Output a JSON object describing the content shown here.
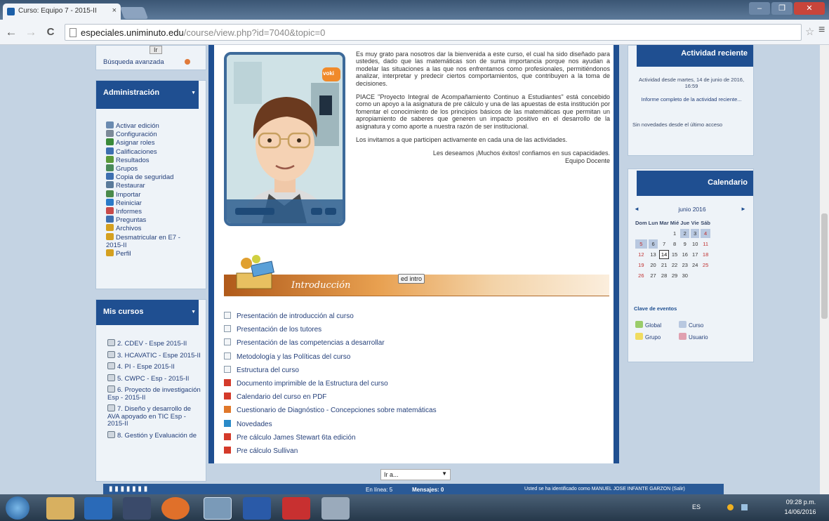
{
  "browser": {
    "tab_title": "Curso: Equipo 7 - 2015-II",
    "tab_close": "×",
    "url_domain": "especiales.uniminuto.edu",
    "url_path": "/course/view.php?id=7040&topic=0",
    "back": "←",
    "forward": "→",
    "reload": "C",
    "star": "☆",
    "menu": "≡",
    "window_buttons": [
      "–",
      "❐",
      "✕"
    ]
  },
  "left": {
    "search_button": "Ir",
    "advanced_search": "Búsqueda avanzada",
    "admin": {
      "title": "Administración",
      "items": [
        {
          "label": "Activar edición",
          "icon": "pencil-icon",
          "color": "#6a8ab0"
        },
        {
          "label": "Configuración",
          "icon": "gear-icon",
          "color": "#7c8a99"
        },
        {
          "label": "Asignar roles",
          "icon": "users-icon",
          "color": "#3a8a3a"
        },
        {
          "label": "Calificaciones",
          "icon": "grades-icon",
          "color": "#3d6fb0"
        },
        {
          "label": "Resultados",
          "icon": "results-icon",
          "color": "#5a9a3a"
        },
        {
          "label": "Grupos",
          "icon": "groups-icon",
          "color": "#4a8a5a"
        },
        {
          "label": "Copia de seguridad",
          "icon": "backup-icon",
          "color": "#3d6fb0"
        },
        {
          "label": "Restaurar",
          "icon": "restore-icon",
          "color": "#5a7a9a"
        },
        {
          "label": "Importar",
          "icon": "import-icon",
          "color": "#4a8a4a"
        },
        {
          "label": "Reiniciar",
          "icon": "reset-icon",
          "color": "#2a7ac8"
        },
        {
          "label": "Informes",
          "icon": "reports-icon",
          "color": "#c84a4a"
        },
        {
          "label": "Preguntas",
          "icon": "questions-icon",
          "color": "#3d6fb0"
        },
        {
          "label": "Archivos",
          "icon": "files-icon",
          "color": "#d4a020"
        },
        {
          "label": "Desmatricular en E7 - 2015-II",
          "icon": "unenrol-icon",
          "color": "#d4a020"
        },
        {
          "label": "Perfil",
          "icon": "profile-icon",
          "color": "#d4a020"
        }
      ]
    },
    "courses": {
      "title": "Mis cursos",
      "items": [
        "2. CDEV - Espe 2015-II",
        "3. HCAVATIC - Espe 2015-II",
        "4. PI - Espe 2015-II",
        "5. CWPC - Esp - 2015-II",
        "6. Proyecto de investigación Esp - 2015-II",
        "7. Diseño y desarrollo de AVA apoyado en TIC Esp - 2015-II",
        "8. Gestión y Evaluación de"
      ]
    }
  },
  "center": {
    "avatar_badge": "voki",
    "intro_paragraphs": [
      "Es muy grato para nosotros dar la bienvenida a este curso, el cual ha sido diseñado para ustedes, dado que las matemáticas son de suma importancia porque nos ayudan a modelar las situaciones a las que nos enfrentamos como profesionales, permitiéndonos analizar, interpretar y predecir ciertos comportamientos, que contribuyen a la toma de decisiones.",
      "PIACE \"Proyecto Integral de Acompañamiento Continuo a Estudiantes\" está concebido como un apoyo a la asignatura de pre cálculo y una de las apuestas de esta institución por fomentar el conocimiento de los principios básicos de las matemáticas que permitan un apropiamiento de saberes que generen un impacto positivo en el desarrollo de la asignatura y como aporte a nuestra razón de ser institucional.",
      "Los invitamos a que participen activamente en cada una de las actividades."
    ],
    "closing": "Les deseamos ¡Muchos éxitos! confiamos en sus capacidades.",
    "signature": "Equipo Docente",
    "banner_title": "Introducción",
    "edit_button": "ed intro",
    "activities": [
      {
        "label": "Presentación de introducción al curso",
        "icon": "page-icon",
        "color": "#8a9aaa"
      },
      {
        "label": "Presentación de los tutores",
        "icon": "page-icon",
        "color": "#8a9aaa"
      },
      {
        "label": "Presentación de las competencias a desarrollar",
        "icon": "page-icon",
        "color": "#8a9aaa"
      },
      {
        "label": "Metodología y las Políticas del curso",
        "icon": "page-icon",
        "color": "#8a9aaa"
      },
      {
        "label": "Estructura del curso",
        "icon": "page-icon",
        "color": "#8a9aaa"
      },
      {
        "label": "Documento imprimible de la Estructura del curso",
        "icon": "pdf-icon",
        "color": "#d43a2a"
      },
      {
        "label": "Calendario del curso en PDF",
        "icon": "pdf-icon",
        "color": "#d43a2a"
      },
      {
        "label": "Cuestionario de Diagnóstico - Concepciones sobre matemáticas",
        "icon": "quiz-icon",
        "color": "#e0782a"
      },
      {
        "label": "Novedades",
        "icon": "forum-icon",
        "color": "#2a8ac8"
      },
      {
        "label": "Pre cálculo James Stewart 6ta edición",
        "icon": "pdf-icon",
        "color": "#d43a2a"
      },
      {
        "label": "Pre cálculo Sullivan",
        "icon": "pdf-icon",
        "color": "#d43a2a"
      }
    ],
    "jump_select": "Ir a..."
  },
  "right": {
    "activity": {
      "title": "Actividad reciente",
      "since": "Actividad desde martes, 14 de junio de 2016, 16:59",
      "full_report": "Informe completo de la actividad reciente...",
      "no_news": "Sin novedades desde el último acceso"
    },
    "calendar": {
      "title": "Calendario",
      "month": "junio 2016",
      "weekdays": [
        "Dom",
        "Lun",
        "Mar",
        "Mié",
        "Jue",
        "Vie",
        "Sáb"
      ],
      "weeks": [
        [
          "",
          "",
          "",
          "1",
          "2",
          "3",
          "4"
        ],
        [
          "5",
          "6",
          "7",
          "8",
          "9",
          "10",
          "11"
        ],
        [
          "12",
          "13",
          "14",
          "15",
          "16",
          "17",
          "18"
        ],
        [
          "19",
          "20",
          "21",
          "22",
          "23",
          "24",
          "25"
        ],
        [
          "26",
          "27",
          "28",
          "29",
          "30",
          "",
          ""
        ]
      ],
      "today": "14",
      "event_days": [
        "2",
        "3",
        "4",
        "5",
        "6"
      ],
      "legend_title": "Clave de eventos",
      "legend": [
        "Global",
        "Curso",
        "Grupo",
        "Usuario"
      ],
      "prev": "◄",
      "next": "►"
    }
  },
  "footer": {
    "online": "En línea: 5",
    "messages": "Mensajes: 0",
    "user": "Usted se ha identificado como MANUEL JOSE INFANTE GARZON (Salir)"
  },
  "taskbar": {
    "time": "09:28 p.m.",
    "date": "14/06/2016",
    "lang": "ES"
  }
}
